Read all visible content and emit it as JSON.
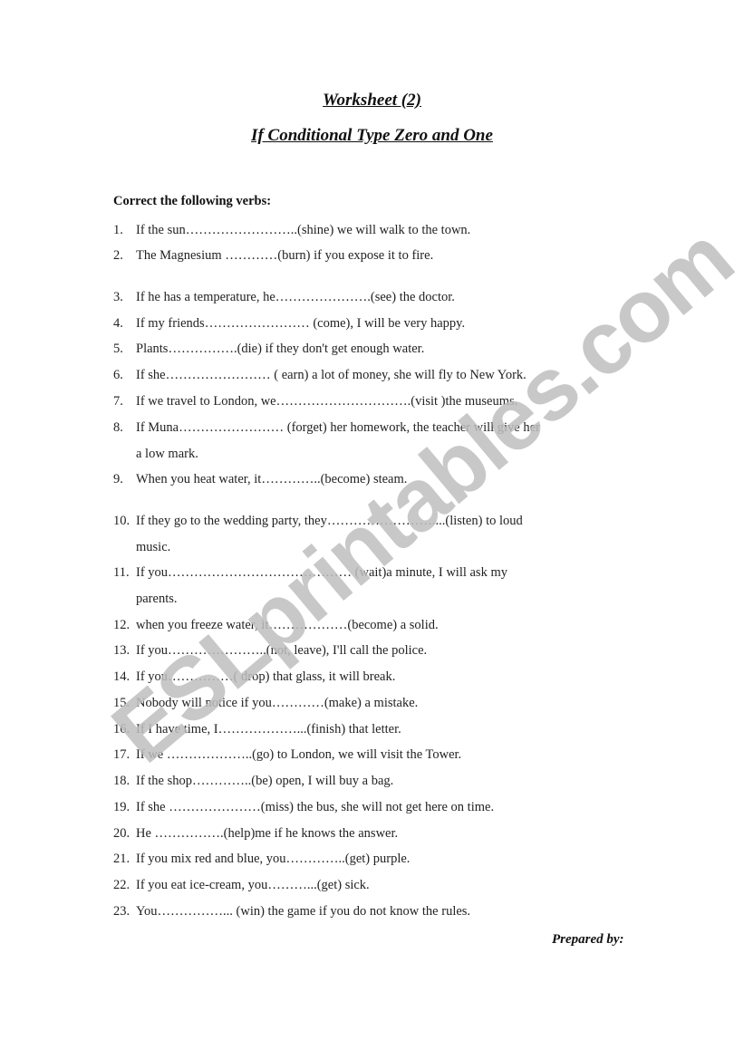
{
  "worksheet": {
    "title": "Worksheet  (2)",
    "subtitle": "If Conditional Type Zero and One",
    "instruction": "Correct the following verbs:",
    "items": [
      {
        "num": "1.",
        "text": "If the sun……………………..(shine) we will walk to the town."
      },
      {
        "num": "2.",
        "text": "The Magnesium …………(burn) if you expose it to fire."
      },
      {
        "num": "3.",
        "text": "If he has a temperature, he………………….(see) the doctor."
      },
      {
        "num": "4.",
        "text": "If my friends…………………… (come), I will be very happy."
      },
      {
        "num": "5.",
        "text": "Plants…………….(die) if they don't get enough water."
      },
      {
        "num": "6.",
        "text": "If she…………………… ( earn) a lot of money, she will fly to New York."
      },
      {
        "num": "7.",
        "text": "If we travel to London, we………………………….(visit )the museums."
      },
      {
        "num": "8.",
        "text": "If  Muna…………………… (forget) her homework, the teacher will give her",
        "cont": "a low mark."
      },
      {
        "num": "9.",
        "text": "When you heat water, it…………..(become) steam."
      },
      {
        "num": "10.",
        "text": "If they go to the wedding party, they……………………....(listen) to loud",
        "cont": "music."
      },
      {
        "num": "11.",
        "text": "If you…………………………………… (wait)a minute, I will ask my",
        "cont": "parents."
      },
      {
        "num": "12.",
        "text": "when you freeze water, it………………(become) a solid."
      },
      {
        "num": "13.",
        "text": "If you…………………..(not, leave), I'll call the police."
      },
      {
        "num": "14.",
        "text": "If you……………( drop) that glass, it will break."
      },
      {
        "num": "15.",
        "text": "Nobody will notice if you…………(make)  a mistake."
      },
      {
        "num": "16.",
        "text": "If I have time, I………………...(finish) that letter."
      },
      {
        "num": "17.",
        "text": "If we ………………..(go) to London, we will visit the Tower."
      },
      {
        "num": "18.",
        "text": "If the shop…………..(be) open, I will buy  a bag."
      },
      {
        "num": "19.",
        "text": "If she …………………(miss) the bus, she will not get here on time."
      },
      {
        "num": "20.",
        "text": "He …………….(help)me if he knows the answer."
      },
      {
        "num": "21.",
        "text": "If you mix red and blue, you…………..(get) purple."
      },
      {
        "num": "22.",
        "text": "If you eat  ice-cream,  you………...(get) sick."
      },
      {
        "num": "23.",
        "text": "You……………... (win) the game if you do not know the rules."
      }
    ],
    "prepared_by": "Prepared  by:"
  },
  "watermark": "ESLprintables.com"
}
